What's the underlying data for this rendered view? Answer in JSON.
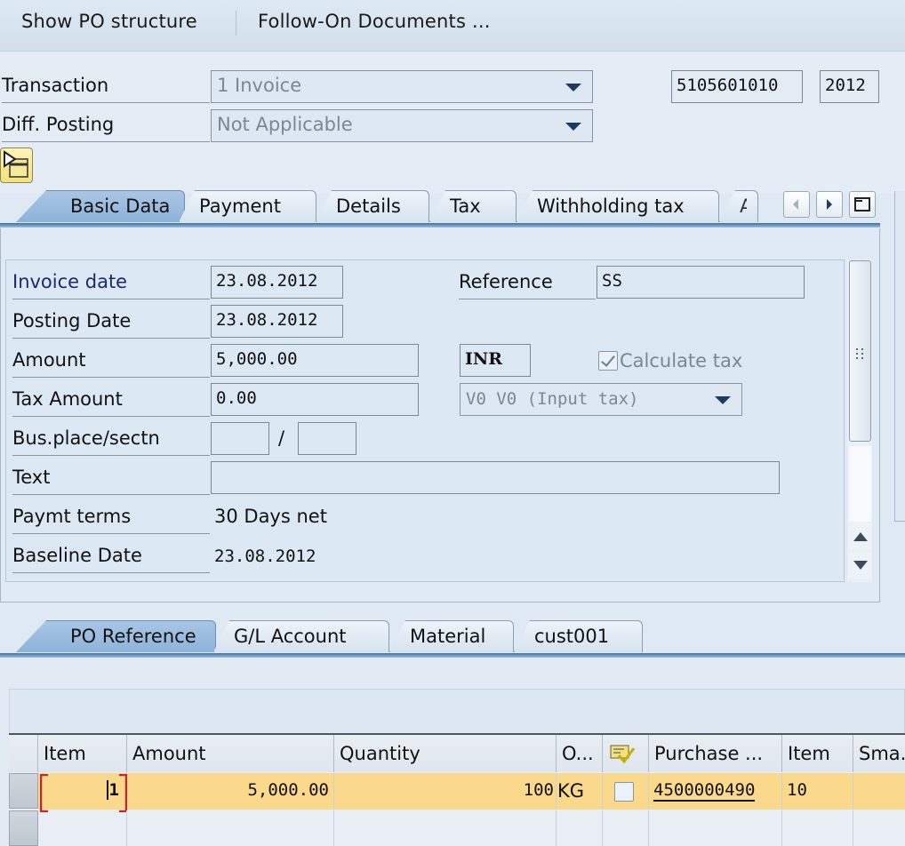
{
  "toolbar": {
    "show_po_structure": "Show PO structure",
    "follow_on_documents": "Follow-On Documents ..."
  },
  "header": {
    "transaction_label": "Transaction",
    "transaction_value": "1 Invoice",
    "diff_posting_label": "Diff. Posting",
    "diff_posting_value": "Not Applicable",
    "document_number": "5105601010",
    "fiscal_year": "2012",
    "toggle_button_icon": "show-hide-worklist-icon"
  },
  "main_tabs": [
    {
      "label": "Basic Data",
      "active": true
    },
    {
      "label": "Payment",
      "active": false
    },
    {
      "label": "Details",
      "active": false
    },
    {
      "label": "Tax",
      "active": false
    },
    {
      "label": "Withholding tax",
      "active": false
    },
    {
      "label": "A",
      "active": false
    }
  ],
  "basic_data": {
    "invoice_date_label": "Invoice date",
    "invoice_date": "23.08.2012",
    "posting_date_label": "Posting Date",
    "posting_date": "23.08.2012",
    "amount_label": "Amount",
    "amount": "5,000.00",
    "currency": "INR",
    "calculate_tax_label": "Calculate tax",
    "calculate_tax_checked": true,
    "tax_amount_label": "Tax Amount",
    "tax_amount": "0.00",
    "tax_code": "V0 V0 (Input tax)",
    "bus_place_label": "Bus.place/sectn",
    "bus_place_value": "",
    "section_value": "",
    "separator": "/",
    "text_label": "Text",
    "text_value": "",
    "reference_label": "Reference",
    "reference": "SS",
    "payment_terms_label": "Paymt terms",
    "payment_terms": "30 Days net",
    "baseline_date_label": "Baseline Date",
    "baseline_date": "23.08.2012"
  },
  "item_tabs": [
    {
      "label": "PO Reference",
      "active": true
    },
    {
      "label": "G/L Account",
      "active": false
    },
    {
      "label": "Material",
      "active": false
    },
    {
      "label": "cust001",
      "active": false
    }
  ],
  "items_table": {
    "columns": [
      "Item",
      "Amount",
      "Quantity",
      "O...",
      "",
      "Purchase ...",
      "Item",
      "Sma."
    ],
    "rows": [
      {
        "item": "1",
        "amount": "5,000.00",
        "quantity": "100",
        "unit": "KG",
        "check": false,
        "po_number": "4500000490",
        "po_item": "10",
        "small": ""
      }
    ]
  },
  "colors": {
    "selected_row": "#fad98c",
    "active_tab": "#8db3da",
    "background": "#dfe9f3"
  }
}
